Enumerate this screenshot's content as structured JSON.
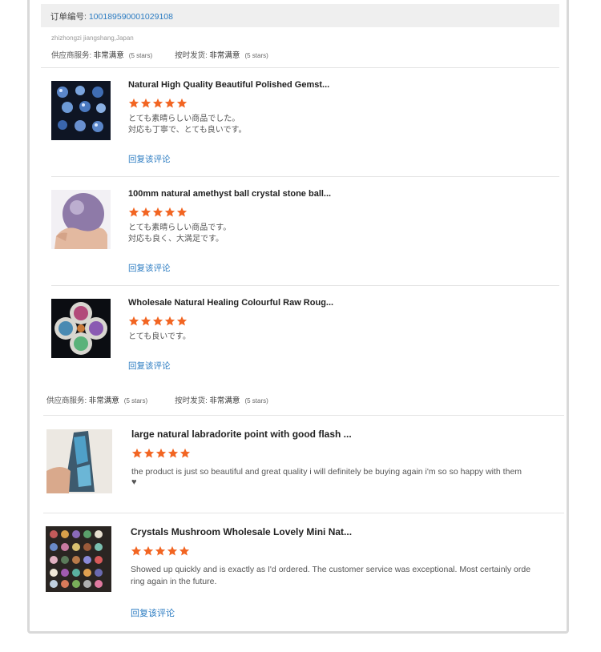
{
  "order": {
    "label": "订单编号:",
    "number": "100189590001029108"
  },
  "buyer_name": "zhizhongzi jiangshang,Japan",
  "rating_block_1": {
    "supplier_label": "供应商服务:",
    "supplier_value": "非常满意",
    "supplier_stars": "(5 stars)",
    "ontime_label": "按时发货:",
    "ontime_value": "非常满意",
    "ontime_stars": "(5 stars)"
  },
  "rating_block_2": {
    "supplier_label": "供应商服务:",
    "supplier_value": "非常满意",
    "supplier_stars": "(5 stars)",
    "ontime_label": "按时发货:",
    "ontime_value": "非常满意",
    "ontime_stars": "(5 stars)"
  },
  "reviews": [
    {
      "title": "Natural High Quality Beautiful Polished Gemst...",
      "stars": 5,
      "text": "とても素晴らしい商品でした。\n対応も丁寧で、とても良いです。",
      "reply": "回复该评论",
      "thumb_icon": "crystal-spheres-photo"
    },
    {
      "title": "100mm natural amethyst ball crystal stone ball...",
      "stars": 5,
      "text": "とても素晴らしい商品です。\n対応も良く、大満足です。",
      "reply": "回复该评论",
      "thumb_icon": "amethyst-ball-photo"
    },
    {
      "title": "Wholesale Natural Healing Colourful Raw Roug...",
      "stars": 5,
      "text": "とても良いです。",
      "reply": "回复该评论",
      "thumb_icon": "crystal-bowls-photo"
    },
    {
      "title": "large natural labradorite point with good flash ...",
      "stars": 5,
      "text": "the product is just so beautiful and great quality i will definitely be buying again i'm so so happy with them",
      "heart": "♥",
      "thumb_icon": "labradorite-point-photo"
    },
    {
      "title": "Crystals Mushroom Wholesale Lovely Mini Nat...",
      "stars": 5,
      "text": "Showed up quickly and is exactly as I'd ordered. The customer service was exceptional. Most certainly orde\nring again in the future.",
      "reply": "回复该评论",
      "thumb_icon": "crystal-mushrooms-photo"
    }
  ],
  "colors": {
    "star": "#f26522",
    "link": "#2c7cc2",
    "bar": "#efefef",
    "frame": "#d9d9d9"
  }
}
